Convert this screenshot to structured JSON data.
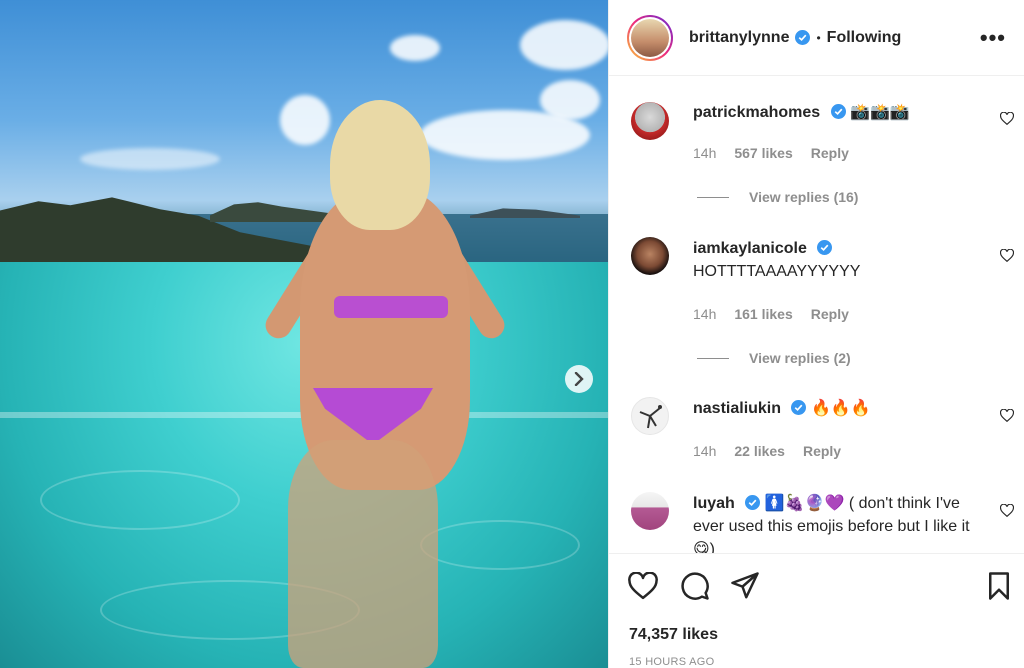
{
  "post": {
    "username": "brittanylynne",
    "follow_dot": "•",
    "follow_status": "Following",
    "more_label": "•••",
    "image_alt": "Woman in purple bikini standing in an infinity pool overlooking the sea"
  },
  "comments": [
    {
      "user": "patrickmahomes",
      "text": "📸📸📸",
      "time": "14h",
      "likes": "567 likes",
      "reply_label": "Reply",
      "view_replies": "View replies (16)"
    },
    {
      "user": "iamkaylanicole",
      "text": "HOTTTTAAAAYYYYYY",
      "time": "14h",
      "likes": "161 likes",
      "reply_label": "Reply",
      "view_replies": "View replies (2)"
    },
    {
      "user": "nastialiukin",
      "text": "🔥🔥🔥",
      "time": "14h",
      "likes": "22 likes",
      "reply_label": "Reply"
    },
    {
      "user": "luyah",
      "text": "🚺🍇🔮💜 ( don't think I've ever used this emojis before but I like it😋)"
    }
  ],
  "footer": {
    "likes_total": "74,357 likes",
    "time_ago": "15 HOURS AGO"
  },
  "colors": {
    "verified": "#3897f0",
    "muted_text": "#8e8e8e",
    "primary_text": "#262626"
  }
}
